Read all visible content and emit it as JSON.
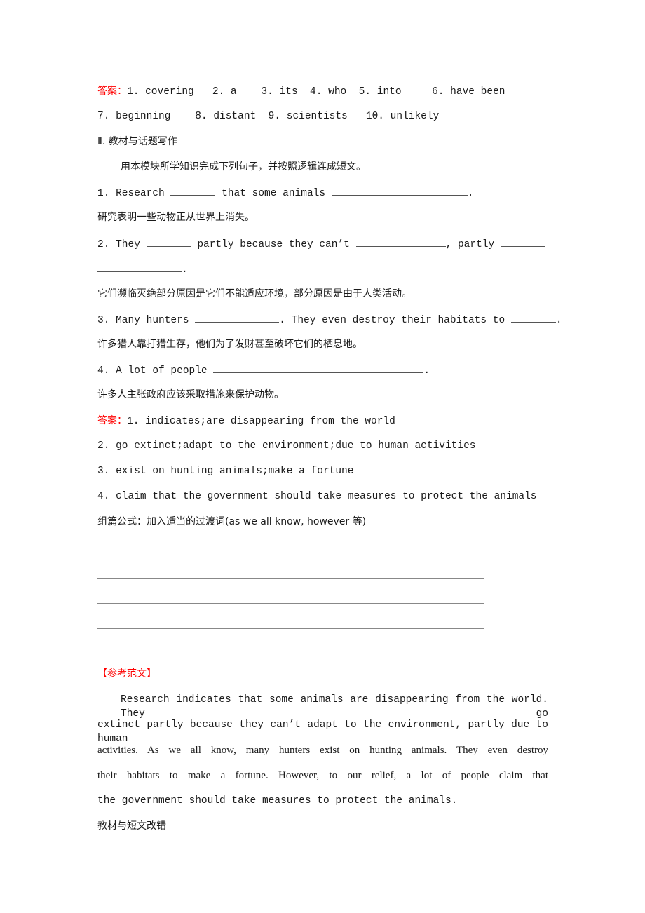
{
  "answers1": {
    "label": "答案：",
    "line1": "1. covering   2. a    3. its  4. who  5. into     6. have been",
    "line2": "7. beginning    8. distant  9. scientists   10. unlikely"
  },
  "section2": {
    "heading": "Ⅱ. 教材与话题写作",
    "instruction": "用本模块所学知识完成下列句子，并按照逻辑连成短文。",
    "items": [
      {
        "parts": [
          "1. Research ",
          " that some animals ",
          "."
        ],
        "translation": "研究表明一些动物正从世界上消失。"
      },
      {
        "parts": [
          "2. They ",
          " partly because they can’t ",
          ", partly ",
          "."
        ],
        "translation": "它们濒临灭绝部分原因是它们不能适应环境，部分原因是由于人类活动。"
      },
      {
        "parts": [
          "3. Many hunters ",
          ". They even destroy their habitats to ",
          "."
        ],
        "translation": "许多猎人靠打猎生存，他们为了发财甚至破坏它们的栖息地。"
      },
      {
        "parts": [
          "4. A lot of people ",
          "."
        ],
        "translation": "许多人主张政府应该采取措施来保护动物。"
      }
    ]
  },
  "answers2": {
    "label": "答案：",
    "lines": [
      "1. indicates;are disappearing from the world",
      "2. go extinct;adapt to the environment;due to human activities",
      "3. exist on hunting animals;make a fortune",
      "4. claim that the government should take measures to protect the animals"
    ],
    "formula": "组篇公式：加入适当的过渡词(as we all know, however 等)"
  },
  "writing_lines_count": 5,
  "sample": {
    "heading": "【参考范文】",
    "lines": [
      "Research indicates that some animals are disappearing from the world. They go",
      "extinct partly because they can’t adapt to the environment, partly due to human",
      "activities. As we all know, many hunters exist on hunting animals. They even destroy",
      "their habitats to make a fortune. However, to our relief, a lot of people claim that",
      "the government should take measures to protect the animals."
    ]
  },
  "next_section": "教材与短文改错",
  "colors": {
    "answer_label": "#ff0000",
    "text": "#1a1a1a"
  }
}
